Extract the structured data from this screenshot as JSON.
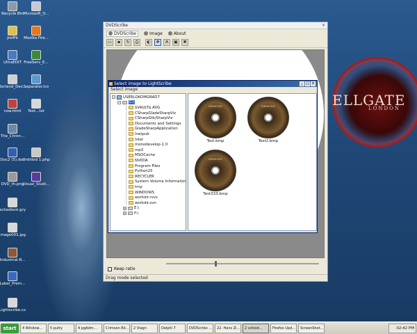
{
  "desktop": {
    "wallpaper_title": "ELLGATE",
    "wallpaper_subtitle": "LONDON",
    "icons": [
      {
        "name": "recycle-bin",
        "label": "Recycle Bin",
        "color": "#8a9aa8"
      },
      {
        "name": "microsoft-office",
        "label": "Microsoft_O...",
        "color": "#c8c8d8"
      },
      {
        "name": "jrefpk",
        "label": "JrefPk",
        "color": "#e0c050"
      },
      {
        "name": "firefox",
        "label": "Mozilla Fire...",
        "color": "#e07a20"
      },
      {
        "name": "ultraedit",
        "label": "UltraEDIT",
        "color": "#4a7ac0"
      },
      {
        "name": "freeserv",
        "label": "FreeServ_E...",
        "color": "#3a8a3a"
      },
      {
        "name": "borland",
        "label": "Borland_Dev...",
        "color": "#d0d0d0"
      },
      {
        "name": "separators",
        "label": "Separator.ico",
        "color": "#5a9ad0"
      },
      {
        "name": "cowhat",
        "label": "cow.html",
        "color": "#c04040"
      },
      {
        "name": "text",
        "label": "Text...txt",
        "color": "#d8d8d8"
      },
      {
        "name": "the-chron",
        "label": "The_Chron...",
        "color": "#6a8aa8"
      },
      {
        "name": "doc2",
        "label": "Doc2 (5).doc",
        "color": "#3060b0"
      },
      {
        "name": "untitled",
        "label": "Untitled 1.php",
        "color": "#c8c8c8"
      },
      {
        "name": "dvd-iso",
        "label": "DVD_th.png",
        "color": "#9a9a9a"
      },
      {
        "name": "visual-studio",
        "label": "Visual_Studi...",
        "color": "#5a3a9a"
      },
      {
        "name": "echodient",
        "label": "echodient.gry",
        "color": "#d8d8d8"
      },
      {
        "name": "image001",
        "label": "image001.jpg",
        "color": "#d8d8d8"
      },
      {
        "name": "industrial",
        "label": "Industrial-R...",
        "color": "#8a5a3a"
      },
      {
        "name": "label-print",
        "label": "Label_Prem...",
        "color": "#3a6ac0"
      },
      {
        "name": "lightscribe",
        "label": "Lightscribe.cs",
        "color": "#d8d8d8"
      }
    ]
  },
  "main_window": {
    "title": "DVDScribe",
    "tabs": [
      {
        "label": "DVDScribe",
        "active": true
      },
      {
        "label": "Image",
        "active": false
      },
      {
        "label": "About",
        "active": false
      }
    ],
    "toolbar": [
      {
        "name": "open-icon",
        "glyph": "▭"
      },
      {
        "name": "save-icon",
        "glyph": "▪"
      },
      {
        "name": "refresh-icon",
        "glyph": "↻"
      },
      {
        "name": "print-icon",
        "glyph": "⎙"
      },
      {
        "name": "burn-icon",
        "glyph": "◐"
      },
      {
        "name": "move-icon",
        "glyph": "✥"
      },
      {
        "name": "text-icon",
        "glyph": "A"
      },
      {
        "name": "image-icon",
        "glyph": "▣"
      },
      {
        "name": "delete-icon",
        "glyph": "✖"
      }
    ],
    "keep_ratio_label": "Keep ratio",
    "status": "Drag mode selected"
  },
  "dialog": {
    "title": "Select image to LightScribe",
    "menu_label": "Select image",
    "tree": {
      "root": "USERLQKOMGRAD7",
      "drive": "C:\\",
      "folders": [
        "$VAULT$.AVG",
        "CSharpGladeSharpViz",
        "CSharpGtk/SharpViz",
        "Documents and Settings",
        "GladeSharpApplication",
        "Inetpub",
        "Intel",
        "monodevelop-1.0",
        "mp3",
        "MSOCache",
        "NVIDIA",
        "Program Files",
        "Python25",
        "RECYCLER",
        "System Volume Information",
        "tmp",
        "WINDOWS",
        "workdir.rvvs",
        "workdir.svn"
      ],
      "other_drives": [
        "E:\\",
        "F:\\"
      ]
    },
    "thumbnails": [
      {
        "caption": "Test.bmp",
        "disc_text": "DEMONS"
      },
      {
        "caption": "Test2.bmp",
        "disc_text": "DEMONS"
      },
      {
        "caption": "Test333.bmp",
        "disc_text": "DEMONS"
      }
    ]
  },
  "taskbar": {
    "start_label": "start",
    "tasks": [
      {
        "label": "4 Window...",
        "active": false
      },
      {
        "label": "5 putty",
        "active": false
      },
      {
        "label": "4 pgAdm...",
        "active": false
      },
      {
        "label": "Crimson Ed...",
        "active": false
      },
      {
        "label": "2 Viagn",
        "active": false
      },
      {
        "label": "Delphi 7",
        "active": false
      },
      {
        "label": "DVDScribe ...",
        "active": false
      },
      {
        "label": "22. Hans Zi...",
        "active": false
      },
      {
        "label": "2 vshost...",
        "active": true
      },
      {
        "label": "Firefox Upd...",
        "active": false
      },
      {
        "label": "ScreenShot...",
        "active": false
      }
    ],
    "clock": "02:42 PM"
  }
}
